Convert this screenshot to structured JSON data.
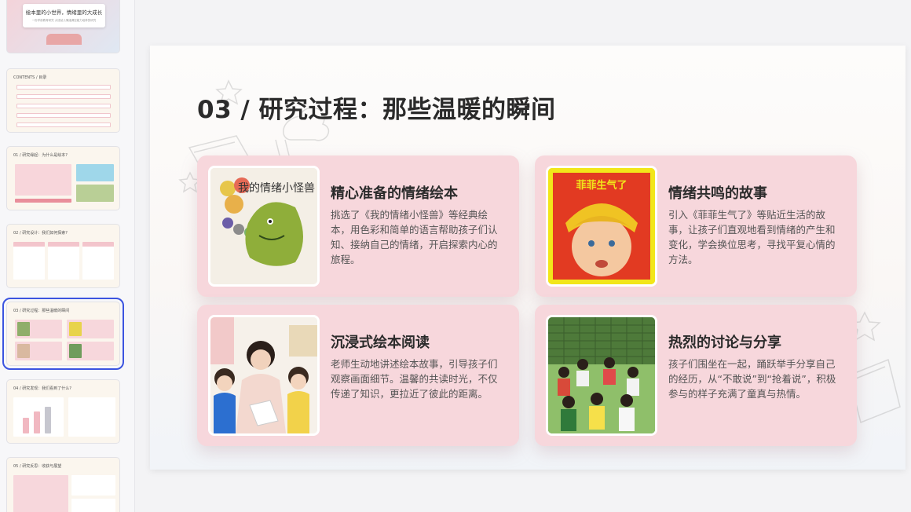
{
  "sidebar": {
    "thumbs": [
      {
        "title": "绘本里的小世界，情绪里的大成长",
        "subtitle": "一份学前教育研究 大班幼儿情绪调控能力培养的研究"
      },
      {
        "title": "CONTENTS / 目录"
      },
      {
        "title": "01 / 研究缘起：为什么是绘本?"
      },
      {
        "title": "02 / 研究设计：我们如何探索?"
      },
      {
        "title": "03 / 研究过程：那些温暖的瞬间"
      },
      {
        "title": "04 / 研究发现：我们看到了什么?"
      },
      {
        "title": "05 / 研究反思：收获与展望"
      }
    ]
  },
  "slide": {
    "title": "03 / 研究过程：那些温暖的瞬间",
    "cards": [
      {
        "title": "精心准备的情绪绘本",
        "text": "挑选了《我的情绪小怪兽》等经典绘本，用色彩和简单的语言帮助孩子们认知、接纳自己的情绪，开启探索内心的旅程。",
        "book_title": "我的情绪小怪兽"
      },
      {
        "title": "情绪共鸣的故事",
        "text": "引入《菲菲生气了》等贴近生活的故事，让孩子们直观地看到情绪的产生和变化，学会换位思考，寻找平复心情的方法。",
        "book_title": "菲菲生气了"
      },
      {
        "title": "沉浸式绘本阅读",
        "text": "老师生动地讲述绘本故事，引导孩子们观察画面细节。温馨的共读时光，不仅传递了知识，更拉近了彼此的距离。"
      },
      {
        "title": "热烈的讨论与分享",
        "text": "孩子们围坐在一起，踊跃举手分享自己的经历，从“不敢说”到“抢着说”，积极参与的样子充满了童真与热情。"
      }
    ]
  },
  "colors": {
    "card_bg": "#f7d7dc",
    "selection": "#3b54e0",
    "title": "#2b2b2b"
  }
}
